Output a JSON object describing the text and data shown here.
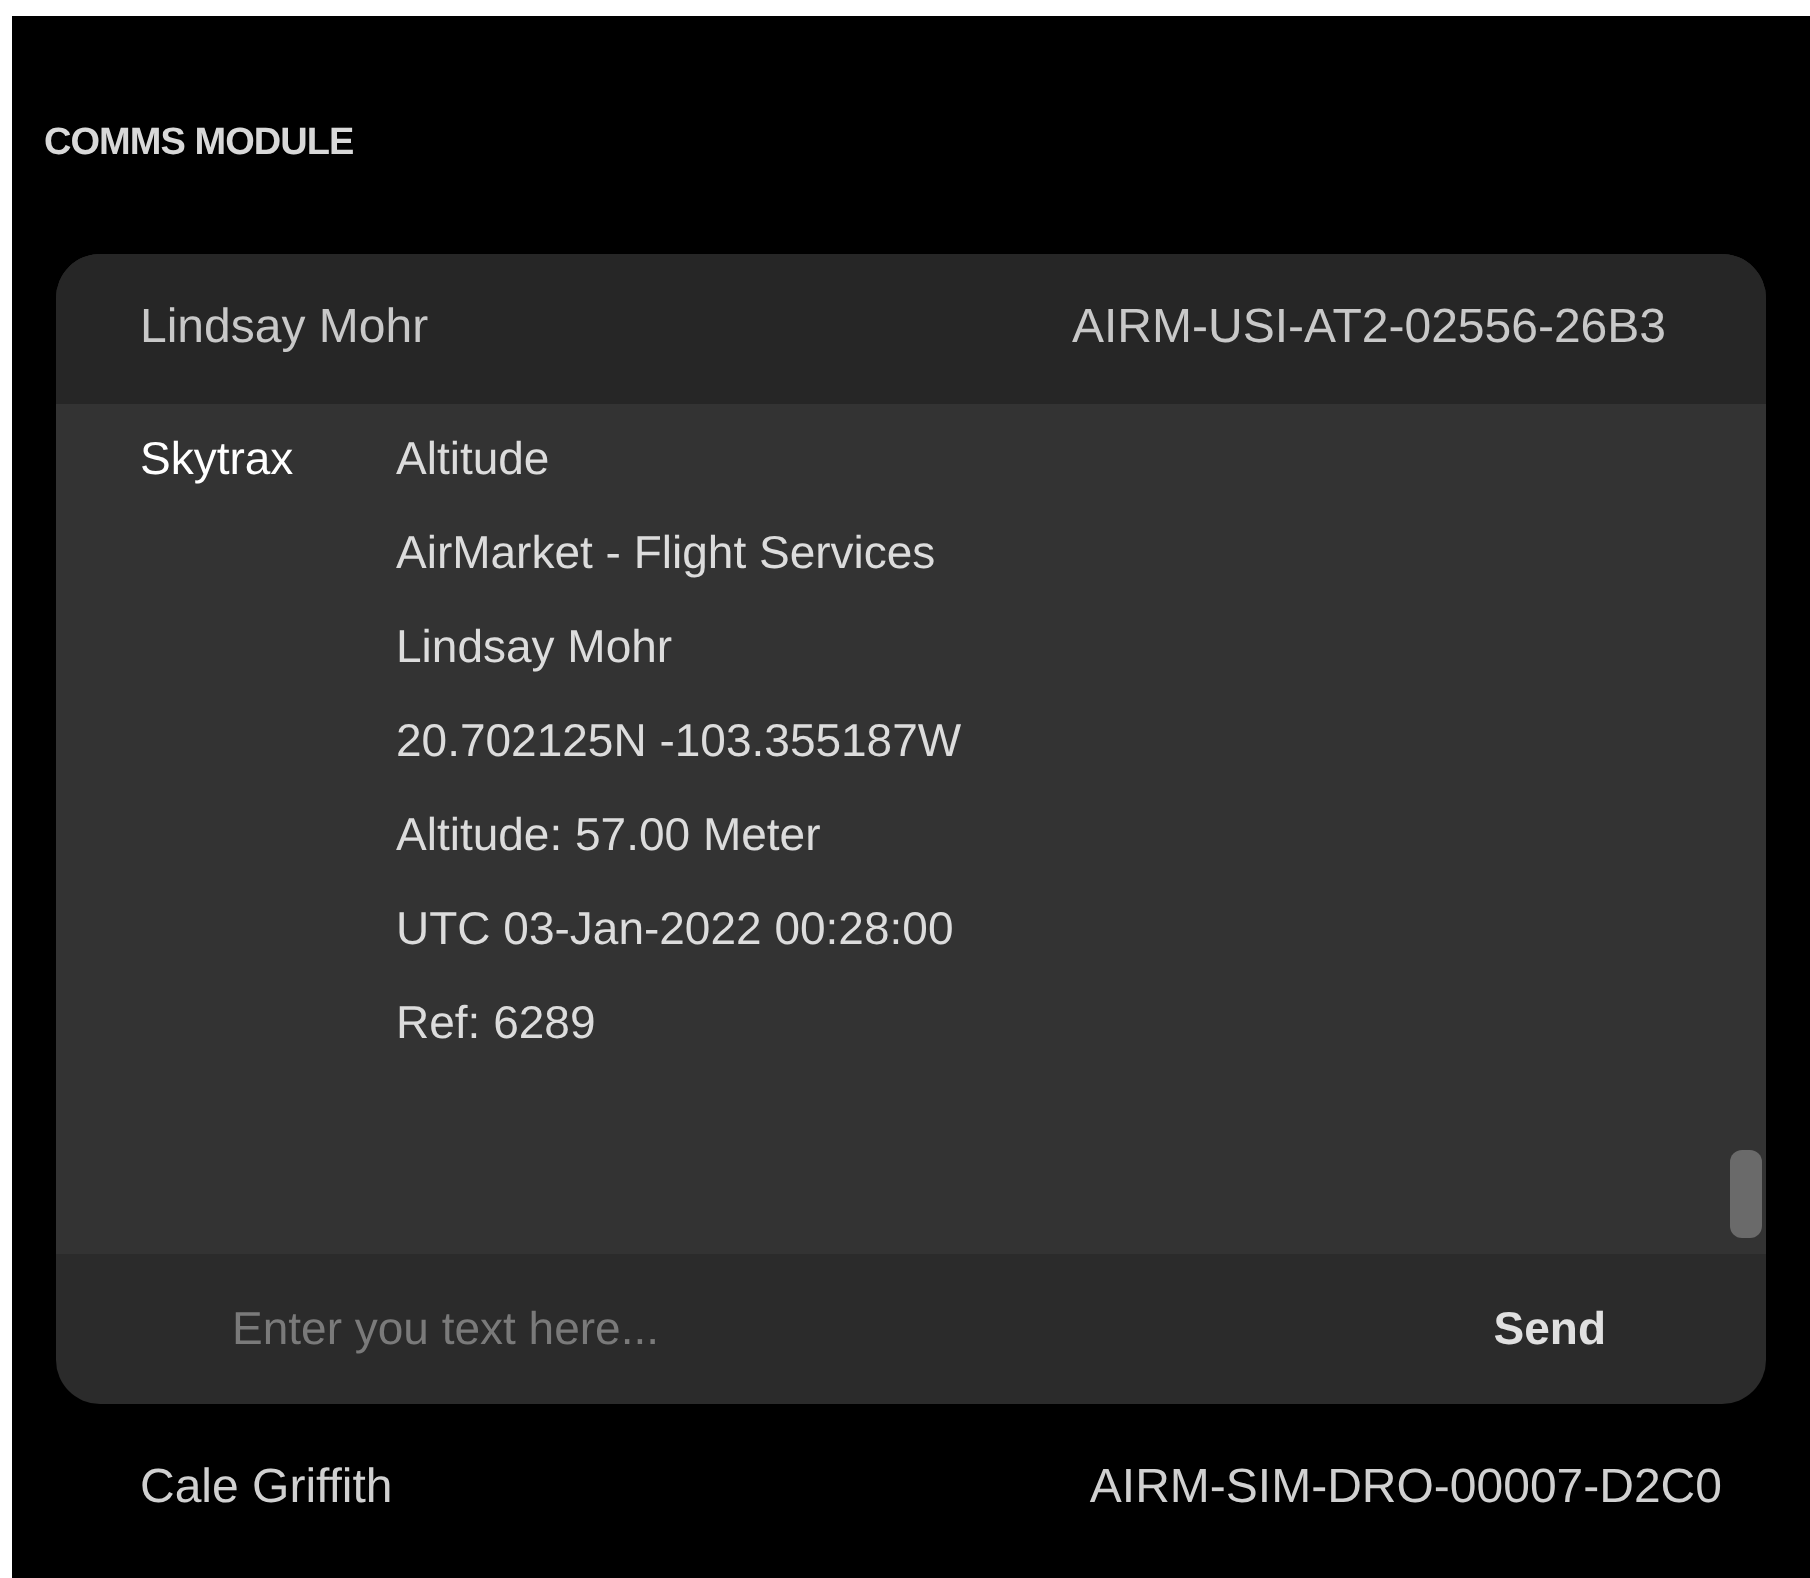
{
  "panel": {
    "title": "COMMS MODULE"
  },
  "active_contact": {
    "name": "Lindsay Mohr",
    "id": "AIRM-USI-AT2-02556-26B3"
  },
  "messages": [
    {
      "sender": "Skytrax",
      "lines": [
        "Altitude",
        "AirMarket - Flight Services",
        "Lindsay Mohr",
        "20.702125N -103.355187W",
        "Altitude: 57.00 Meter",
        "UTC 03-Jan-2022 00:28:00",
        "Ref: 6289"
      ]
    }
  ],
  "composer": {
    "placeholder": "Enter you text here...",
    "send": "Send"
  },
  "contacts": [
    {
      "name": "Cale Griffith",
      "id": "AIRM-SIM-DRO-00007-D2C0"
    }
  ]
}
